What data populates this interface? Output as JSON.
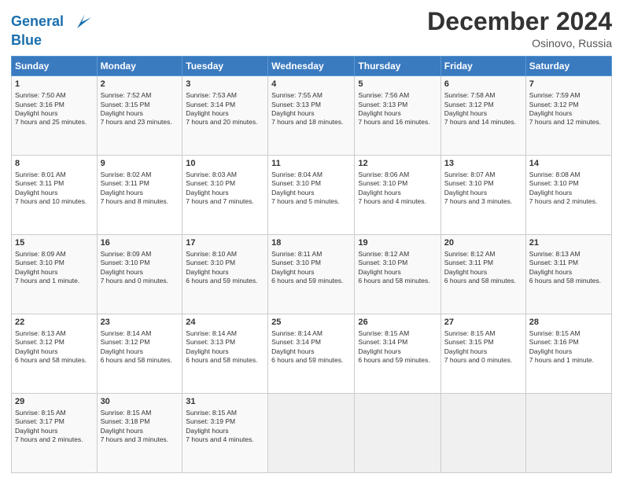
{
  "header": {
    "logo_line1": "General",
    "logo_line2": "Blue",
    "month": "December 2024",
    "location": "Osinovo, Russia"
  },
  "days_of_week": [
    "Sunday",
    "Monday",
    "Tuesday",
    "Wednesday",
    "Thursday",
    "Friday",
    "Saturday"
  ],
  "weeks": [
    [
      {
        "day": "1",
        "sunrise": "7:50 AM",
        "sunset": "3:16 PM",
        "daylight": "7 hours and 25 minutes."
      },
      {
        "day": "2",
        "sunrise": "7:52 AM",
        "sunset": "3:15 PM",
        "daylight": "7 hours and 23 minutes."
      },
      {
        "day": "3",
        "sunrise": "7:53 AM",
        "sunset": "3:14 PM",
        "daylight": "7 hours and 20 minutes."
      },
      {
        "day": "4",
        "sunrise": "7:55 AM",
        "sunset": "3:13 PM",
        "daylight": "7 hours and 18 minutes."
      },
      {
        "day": "5",
        "sunrise": "7:56 AM",
        "sunset": "3:13 PM",
        "daylight": "7 hours and 16 minutes."
      },
      {
        "day": "6",
        "sunrise": "7:58 AM",
        "sunset": "3:12 PM",
        "daylight": "7 hours and 14 minutes."
      },
      {
        "day": "7",
        "sunrise": "7:59 AM",
        "sunset": "3:12 PM",
        "daylight": "7 hours and 12 minutes."
      }
    ],
    [
      {
        "day": "8",
        "sunrise": "8:01 AM",
        "sunset": "3:11 PM",
        "daylight": "7 hours and 10 minutes."
      },
      {
        "day": "9",
        "sunrise": "8:02 AM",
        "sunset": "3:11 PM",
        "daylight": "7 hours and 8 minutes."
      },
      {
        "day": "10",
        "sunrise": "8:03 AM",
        "sunset": "3:10 PM",
        "daylight": "7 hours and 7 minutes."
      },
      {
        "day": "11",
        "sunrise": "8:04 AM",
        "sunset": "3:10 PM",
        "daylight": "7 hours and 5 minutes."
      },
      {
        "day": "12",
        "sunrise": "8:06 AM",
        "sunset": "3:10 PM",
        "daylight": "7 hours and 4 minutes."
      },
      {
        "day": "13",
        "sunrise": "8:07 AM",
        "sunset": "3:10 PM",
        "daylight": "7 hours and 3 minutes."
      },
      {
        "day": "14",
        "sunrise": "8:08 AM",
        "sunset": "3:10 PM",
        "daylight": "7 hours and 2 minutes."
      }
    ],
    [
      {
        "day": "15",
        "sunrise": "8:09 AM",
        "sunset": "3:10 PM",
        "daylight": "7 hours and 1 minute."
      },
      {
        "day": "16",
        "sunrise": "8:09 AM",
        "sunset": "3:10 PM",
        "daylight": "7 hours and 0 minutes."
      },
      {
        "day": "17",
        "sunrise": "8:10 AM",
        "sunset": "3:10 PM",
        "daylight": "6 hours and 59 minutes."
      },
      {
        "day": "18",
        "sunrise": "8:11 AM",
        "sunset": "3:10 PM",
        "daylight": "6 hours and 59 minutes."
      },
      {
        "day": "19",
        "sunrise": "8:12 AM",
        "sunset": "3:10 PM",
        "daylight": "6 hours and 58 minutes."
      },
      {
        "day": "20",
        "sunrise": "8:12 AM",
        "sunset": "3:11 PM",
        "daylight": "6 hours and 58 minutes."
      },
      {
        "day": "21",
        "sunrise": "8:13 AM",
        "sunset": "3:11 PM",
        "daylight": "6 hours and 58 minutes."
      }
    ],
    [
      {
        "day": "22",
        "sunrise": "8:13 AM",
        "sunset": "3:12 PM",
        "daylight": "6 hours and 58 minutes."
      },
      {
        "day": "23",
        "sunrise": "8:14 AM",
        "sunset": "3:12 PM",
        "daylight": "6 hours and 58 minutes."
      },
      {
        "day": "24",
        "sunrise": "8:14 AM",
        "sunset": "3:13 PM",
        "daylight": "6 hours and 58 minutes."
      },
      {
        "day": "25",
        "sunrise": "8:14 AM",
        "sunset": "3:14 PM",
        "daylight": "6 hours and 59 minutes."
      },
      {
        "day": "26",
        "sunrise": "8:15 AM",
        "sunset": "3:14 PM",
        "daylight": "6 hours and 59 minutes."
      },
      {
        "day": "27",
        "sunrise": "8:15 AM",
        "sunset": "3:15 PM",
        "daylight": "7 hours and 0 minutes."
      },
      {
        "day": "28",
        "sunrise": "8:15 AM",
        "sunset": "3:16 PM",
        "daylight": "7 hours and 1 minute."
      }
    ],
    [
      {
        "day": "29",
        "sunrise": "8:15 AM",
        "sunset": "3:17 PM",
        "daylight": "7 hours and 2 minutes."
      },
      {
        "day": "30",
        "sunrise": "8:15 AM",
        "sunset": "3:18 PM",
        "daylight": "7 hours and 3 minutes."
      },
      {
        "day": "31",
        "sunrise": "8:15 AM",
        "sunset": "3:19 PM",
        "daylight": "7 hours and 4 minutes."
      },
      null,
      null,
      null,
      null
    ]
  ]
}
